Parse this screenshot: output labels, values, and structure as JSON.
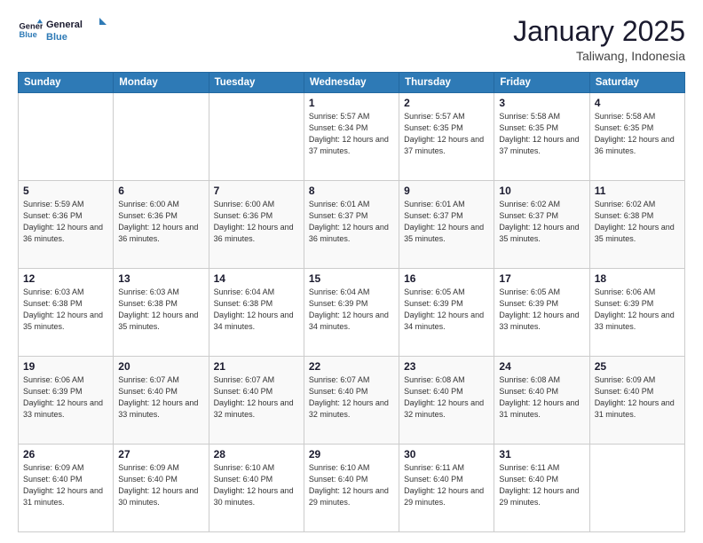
{
  "logo": {
    "line1": "General",
    "line2": "Blue"
  },
  "title": "January 2025",
  "subtitle": "Taliwang, Indonesia",
  "weekdays": [
    "Sunday",
    "Monday",
    "Tuesday",
    "Wednesday",
    "Thursday",
    "Friday",
    "Saturday"
  ],
  "weeks": [
    [
      {
        "day": "",
        "sunrise": "",
        "sunset": "",
        "daylight": ""
      },
      {
        "day": "",
        "sunrise": "",
        "sunset": "",
        "daylight": ""
      },
      {
        "day": "",
        "sunrise": "",
        "sunset": "",
        "daylight": ""
      },
      {
        "day": "1",
        "sunrise": "Sunrise: 5:57 AM",
        "sunset": "Sunset: 6:34 PM",
        "daylight": "Daylight: 12 hours and 37 minutes."
      },
      {
        "day": "2",
        "sunrise": "Sunrise: 5:57 AM",
        "sunset": "Sunset: 6:35 PM",
        "daylight": "Daylight: 12 hours and 37 minutes."
      },
      {
        "day": "3",
        "sunrise": "Sunrise: 5:58 AM",
        "sunset": "Sunset: 6:35 PM",
        "daylight": "Daylight: 12 hours and 37 minutes."
      },
      {
        "day": "4",
        "sunrise": "Sunrise: 5:58 AM",
        "sunset": "Sunset: 6:35 PM",
        "daylight": "Daylight: 12 hours and 36 minutes."
      }
    ],
    [
      {
        "day": "5",
        "sunrise": "Sunrise: 5:59 AM",
        "sunset": "Sunset: 6:36 PM",
        "daylight": "Daylight: 12 hours and 36 minutes."
      },
      {
        "day": "6",
        "sunrise": "Sunrise: 6:00 AM",
        "sunset": "Sunset: 6:36 PM",
        "daylight": "Daylight: 12 hours and 36 minutes."
      },
      {
        "day": "7",
        "sunrise": "Sunrise: 6:00 AM",
        "sunset": "Sunset: 6:36 PM",
        "daylight": "Daylight: 12 hours and 36 minutes."
      },
      {
        "day": "8",
        "sunrise": "Sunrise: 6:01 AM",
        "sunset": "Sunset: 6:37 PM",
        "daylight": "Daylight: 12 hours and 36 minutes."
      },
      {
        "day": "9",
        "sunrise": "Sunrise: 6:01 AM",
        "sunset": "Sunset: 6:37 PM",
        "daylight": "Daylight: 12 hours and 35 minutes."
      },
      {
        "day": "10",
        "sunrise": "Sunrise: 6:02 AM",
        "sunset": "Sunset: 6:37 PM",
        "daylight": "Daylight: 12 hours and 35 minutes."
      },
      {
        "day": "11",
        "sunrise": "Sunrise: 6:02 AM",
        "sunset": "Sunset: 6:38 PM",
        "daylight": "Daylight: 12 hours and 35 minutes."
      }
    ],
    [
      {
        "day": "12",
        "sunrise": "Sunrise: 6:03 AM",
        "sunset": "Sunset: 6:38 PM",
        "daylight": "Daylight: 12 hours and 35 minutes."
      },
      {
        "day": "13",
        "sunrise": "Sunrise: 6:03 AM",
        "sunset": "Sunset: 6:38 PM",
        "daylight": "Daylight: 12 hours and 35 minutes."
      },
      {
        "day": "14",
        "sunrise": "Sunrise: 6:04 AM",
        "sunset": "Sunset: 6:38 PM",
        "daylight": "Daylight: 12 hours and 34 minutes."
      },
      {
        "day": "15",
        "sunrise": "Sunrise: 6:04 AM",
        "sunset": "Sunset: 6:39 PM",
        "daylight": "Daylight: 12 hours and 34 minutes."
      },
      {
        "day": "16",
        "sunrise": "Sunrise: 6:05 AM",
        "sunset": "Sunset: 6:39 PM",
        "daylight": "Daylight: 12 hours and 34 minutes."
      },
      {
        "day": "17",
        "sunrise": "Sunrise: 6:05 AM",
        "sunset": "Sunset: 6:39 PM",
        "daylight": "Daylight: 12 hours and 33 minutes."
      },
      {
        "day": "18",
        "sunrise": "Sunrise: 6:06 AM",
        "sunset": "Sunset: 6:39 PM",
        "daylight": "Daylight: 12 hours and 33 minutes."
      }
    ],
    [
      {
        "day": "19",
        "sunrise": "Sunrise: 6:06 AM",
        "sunset": "Sunset: 6:39 PM",
        "daylight": "Daylight: 12 hours and 33 minutes."
      },
      {
        "day": "20",
        "sunrise": "Sunrise: 6:07 AM",
        "sunset": "Sunset: 6:40 PM",
        "daylight": "Daylight: 12 hours and 33 minutes."
      },
      {
        "day": "21",
        "sunrise": "Sunrise: 6:07 AM",
        "sunset": "Sunset: 6:40 PM",
        "daylight": "Daylight: 12 hours and 32 minutes."
      },
      {
        "day": "22",
        "sunrise": "Sunrise: 6:07 AM",
        "sunset": "Sunset: 6:40 PM",
        "daylight": "Daylight: 12 hours and 32 minutes."
      },
      {
        "day": "23",
        "sunrise": "Sunrise: 6:08 AM",
        "sunset": "Sunset: 6:40 PM",
        "daylight": "Daylight: 12 hours and 32 minutes."
      },
      {
        "day": "24",
        "sunrise": "Sunrise: 6:08 AM",
        "sunset": "Sunset: 6:40 PM",
        "daylight": "Daylight: 12 hours and 31 minutes."
      },
      {
        "day": "25",
        "sunrise": "Sunrise: 6:09 AM",
        "sunset": "Sunset: 6:40 PM",
        "daylight": "Daylight: 12 hours and 31 minutes."
      }
    ],
    [
      {
        "day": "26",
        "sunrise": "Sunrise: 6:09 AM",
        "sunset": "Sunset: 6:40 PM",
        "daylight": "Daylight: 12 hours and 31 minutes."
      },
      {
        "day": "27",
        "sunrise": "Sunrise: 6:09 AM",
        "sunset": "Sunset: 6:40 PM",
        "daylight": "Daylight: 12 hours and 30 minutes."
      },
      {
        "day": "28",
        "sunrise": "Sunrise: 6:10 AM",
        "sunset": "Sunset: 6:40 PM",
        "daylight": "Daylight: 12 hours and 30 minutes."
      },
      {
        "day": "29",
        "sunrise": "Sunrise: 6:10 AM",
        "sunset": "Sunset: 6:40 PM",
        "daylight": "Daylight: 12 hours and 29 minutes."
      },
      {
        "day": "30",
        "sunrise": "Sunrise: 6:11 AM",
        "sunset": "Sunset: 6:40 PM",
        "daylight": "Daylight: 12 hours and 29 minutes."
      },
      {
        "day": "31",
        "sunrise": "Sunrise: 6:11 AM",
        "sunset": "Sunset: 6:40 PM",
        "daylight": "Daylight: 12 hours and 29 minutes."
      },
      {
        "day": "",
        "sunrise": "",
        "sunset": "",
        "daylight": ""
      }
    ]
  ]
}
